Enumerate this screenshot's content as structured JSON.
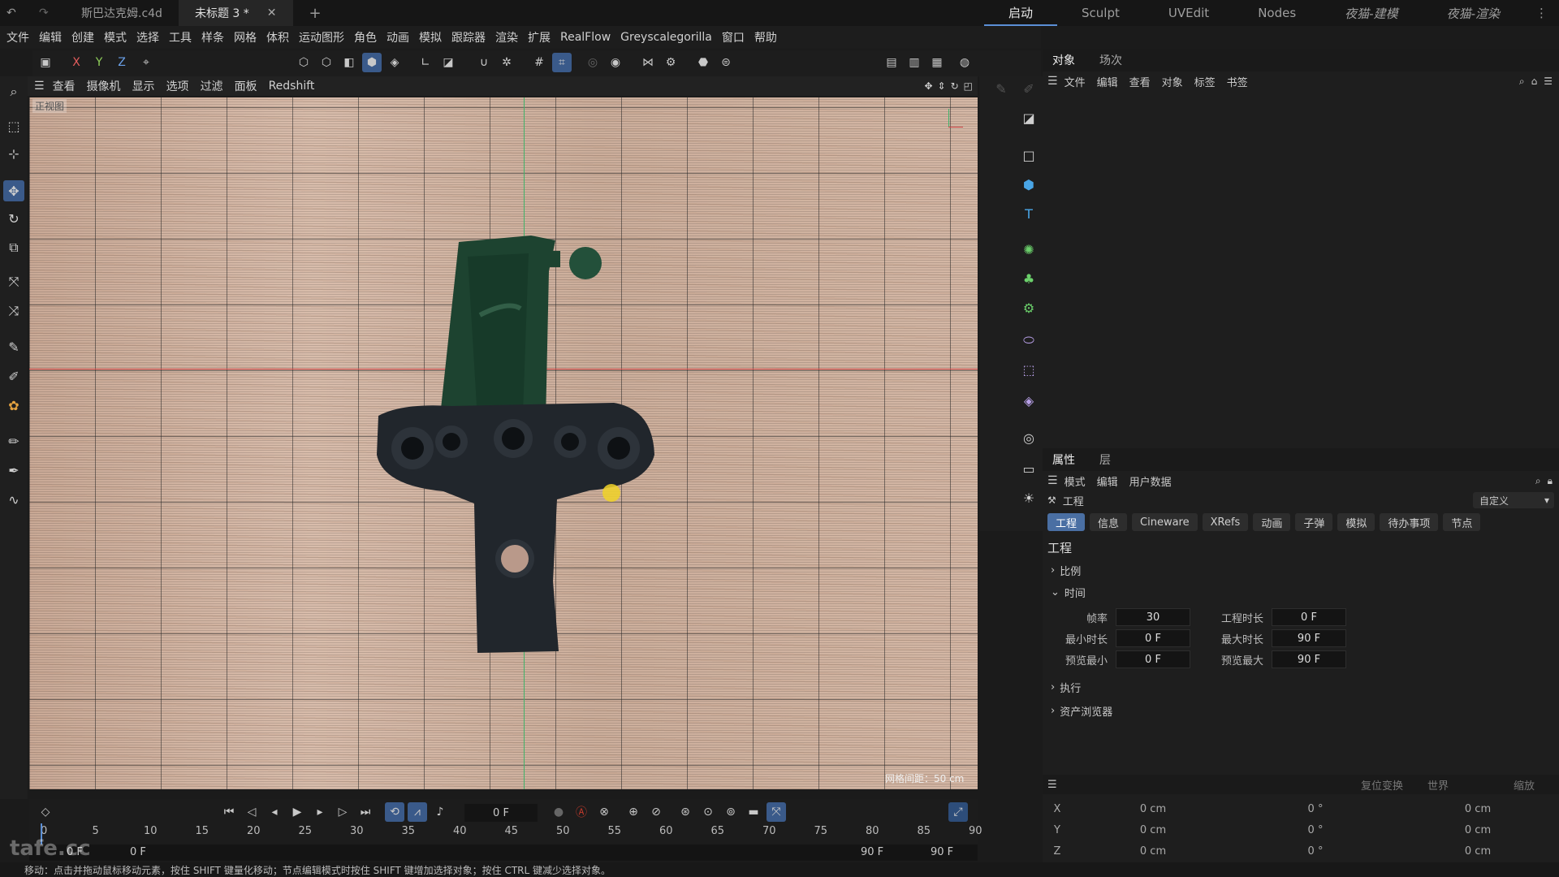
{
  "tabs": [
    {
      "label": "斯巴达克姆.c4d"
    },
    {
      "label": "未标题 3 *"
    }
  ],
  "layouts": [
    "启动",
    "Sculpt",
    "UVEdit",
    "Nodes",
    "夜猫-建模",
    "夜猫-渲染"
  ],
  "menu": [
    "文件",
    "编辑",
    "创建",
    "模式",
    "选择",
    "工具",
    "样条",
    "网格",
    "体积",
    "运动图形",
    "角色",
    "动画",
    "模拟",
    "跟踪器",
    "渲染",
    "扩展",
    "RealFlow",
    "Greyscalegorilla",
    "窗口",
    "帮助"
  ],
  "axis_buttons": {
    "x": "X",
    "y": "Y",
    "z": "Z"
  },
  "viewport_menu": [
    "查看",
    "摄像机",
    "显示",
    "选项",
    "过滤",
    "面板",
    "Redshift"
  ],
  "viewport": {
    "title": "正视图",
    "grid_label": "网格间距：50 cm"
  },
  "object_manager": {
    "tabs": [
      "对象",
      "场次"
    ],
    "menu": [
      "文件",
      "编辑",
      "查看",
      "对象",
      "标签",
      "书签"
    ]
  },
  "attributes": {
    "tabs": [
      "属性",
      "层"
    ],
    "menu": [
      "模式",
      "编辑",
      "用户数据"
    ],
    "header_label": "工程",
    "preset": "自定义",
    "section_tabs": [
      "工程",
      "信息",
      "Cineware",
      "XRefs",
      "动画",
      "子弹",
      "模拟",
      "待办事项",
      "节点"
    ],
    "section_title": "工程",
    "groups": {
      "scale": "比例",
      "time": "时间",
      "execute": "执行",
      "assets": "资产浏览器"
    },
    "fields": [
      {
        "label": "帧率",
        "value": "30"
      },
      {
        "label": "工程时长",
        "value": "0 F"
      },
      {
        "label": "最小时长",
        "value": "0 F"
      },
      {
        "label": "最大时长",
        "value": "90 F"
      },
      {
        "label": "预览最小",
        "value": "0 F"
      },
      {
        "label": "预览最大",
        "value": "90 F"
      }
    ]
  },
  "coords": {
    "labels": [
      "复位变换",
      "世界",
      "缩放"
    ],
    "rows": [
      {
        "axis": "X",
        "a": "0 cm",
        "b": "0 °",
        "c": "0 cm"
      },
      {
        "axis": "Y",
        "a": "0 cm",
        "b": "0 °",
        "c": "0 cm"
      },
      {
        "axis": "Z",
        "a": "0 cm",
        "b": "0 °",
        "c": "0 cm"
      }
    ]
  },
  "timeline": {
    "current_frame": "0 F",
    "ticks": [
      "0",
      "5",
      "10",
      "15",
      "20",
      "25",
      "30",
      "35",
      "40",
      "45",
      "50",
      "55",
      "60",
      "65",
      "70",
      "75",
      "80",
      "85",
      "90"
    ],
    "start": "0 F",
    "start2": "0 F",
    "end": "90 F",
    "end2": "90 F"
  },
  "status": "移动：点击并拖动鼠标移动元素，按住 SHIFT 键量化移动；节点编辑模式时按住 SHIFT 键增加选择对象；按住 CTRL 键减少选择对象。",
  "watermark": "tafe.cc",
  "colors": {
    "accent": "#4a6fa3",
    "record": "#c0392b"
  }
}
